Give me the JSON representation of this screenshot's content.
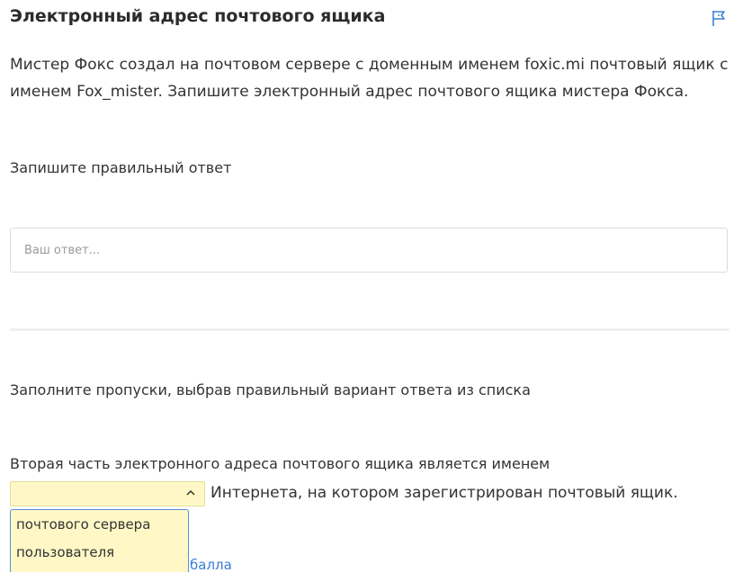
{
  "header": {
    "title": "Электронный адрес почтового ящика",
    "flag_icon": "flag-icon"
  },
  "question": {
    "text": "Мистер Фокс создал на почтовом сервере с доменным именем foxic.mi почтовый ящик с именем Fox_mister. Запишите электронный адрес почтового ящика мистера Фокса."
  },
  "task1": {
    "instruction": "Запишите правильный ответ",
    "answer_placeholder": "Ваш ответ...",
    "answer_value": ""
  },
  "task2": {
    "instruction": "Заполните пропуски, выбрав правильный вариант ответа из списка",
    "sentence_before": "Вторая часть электронного адреса почтового ящика является именем",
    "sentence_after": "Интернета, на котором зарегистрирован почтовый ящик.",
    "selected_value": "",
    "options": [
      "почтового сервера",
      "пользователя"
    ],
    "partial_link_text": "балла"
  },
  "colors": {
    "select_background": "#fff8c6",
    "dropdown_border": "#5a8fd6",
    "flag_icon": "#3b82d6"
  }
}
